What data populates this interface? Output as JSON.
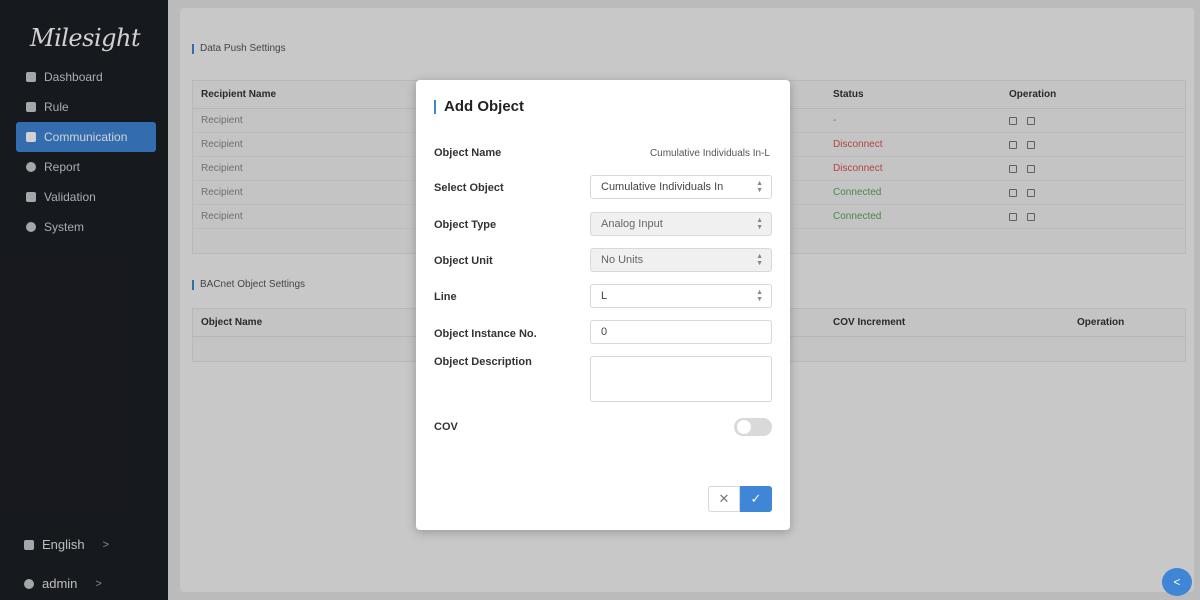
{
  "sidebar": {
    "logo": "Milesight",
    "items": [
      {
        "label": "Dashboard"
      },
      {
        "label": "Rule"
      },
      {
        "label": "Communication"
      },
      {
        "label": "Report"
      },
      {
        "label": "Validation"
      },
      {
        "label": "System"
      }
    ],
    "language": "English",
    "user": "admin"
  },
  "data_push": {
    "title": "Data Push Settings",
    "headers": {
      "name": "Recipient Name",
      "status": "Status",
      "operation": "Operation"
    },
    "rows": [
      {
        "name": "Recipient",
        "status": "-"
      },
      {
        "name": "Recipient",
        "status": "Disconnect"
      },
      {
        "name": "Recipient",
        "status": "Disconnect"
      },
      {
        "name": "Recipient",
        "status": "Connected"
      },
      {
        "name": "Recipient",
        "status": "Connected"
      }
    ]
  },
  "bacnet": {
    "title": "BACnet Object Settings",
    "headers": {
      "name": "Object Name",
      "cov": "COV Increment",
      "operation": "Operation"
    }
  },
  "modal": {
    "title": "Add Object",
    "object_name_label": "Object Name",
    "object_name_value": "Cumulative Individuals In-L",
    "select_object_label": "Select Object",
    "select_object_value": "Cumulative Individuals In",
    "object_type_label": "Object Type",
    "object_type_value": "Analog Input",
    "object_unit_label": "Object Unit",
    "object_unit_value": "No Units",
    "line_label": "Line",
    "line_value": "L",
    "instance_label": "Object Instance No.",
    "instance_value": "0",
    "description_label": "Object Description",
    "description_value": "",
    "cov_label": "COV",
    "cov_enabled": false,
    "cancel_glyph": "✕",
    "ok_glyph": "✓"
  },
  "colors": {
    "accent": "#3f86d6",
    "sidebar_bg": "#1c1f24",
    "disconnect": "#d9534f",
    "connected": "#5aa55a"
  }
}
